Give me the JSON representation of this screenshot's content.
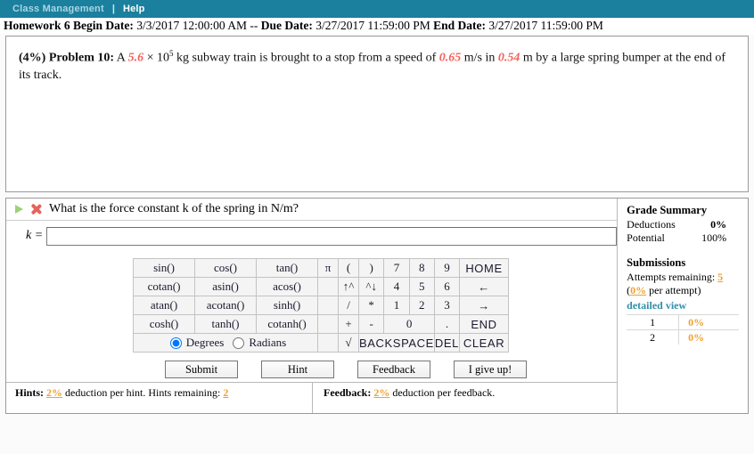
{
  "nav": {
    "class_management": "Class Management",
    "separator": "|",
    "help": "Help"
  },
  "header": {
    "hw_label": "Homework 6 Begin Date:",
    "begin_date": "3/3/2017 12:00:00 AM",
    "dash": "--",
    "due_label": "Due Date:",
    "due_date": "3/27/2017 11:59:00 PM",
    "end_label": "End Date:",
    "end_date": "3/27/2017 11:59:00 PM"
  },
  "problem": {
    "percent": "(4%)",
    "title": "Problem 10:",
    "t1": "A ",
    "mass": "5.6",
    "times": " × 10",
    "exp": "5",
    "t2": " kg subway train is brought to a stop from a speed of ",
    "speed": "0.65",
    "t3": " m/s in ",
    "distance": "0.54",
    "t4": " m by a large spring bumper at the end of its track."
  },
  "question": {
    "text": "What is the force constant k of the spring in N/m?",
    "answer_label": "k =",
    "answer_value": "",
    "answer_placeholder": ""
  },
  "calculator": {
    "rows": [
      [
        "sin()",
        "cos()",
        "tan()",
        "π",
        "(",
        ")",
        "7",
        "8",
        "9",
        "HOME"
      ],
      [
        "cotan()",
        "asin()",
        "acos()",
        "",
        "↑^",
        "^↓",
        "4",
        "5",
        "6",
        "←"
      ],
      [
        "atan()",
        "acotan()",
        "sinh()",
        "",
        "/",
        "*",
        "1",
        "2",
        "3",
        "→"
      ],
      [
        "cosh()",
        "tanh()",
        "cotanh()",
        "",
        "+",
        "-",
        "0",
        ".",
        "END"
      ],
      [
        "",
        "√",
        "BACKSPACE",
        "DEL",
        "CLEAR"
      ]
    ],
    "angle_mode": {
      "degrees": "Degrees",
      "radians": "Radians",
      "selected": "Degrees"
    }
  },
  "buttons": {
    "submit": "Submit",
    "hint": "Hint",
    "feedback": "Feedback",
    "give_up": "I give up!"
  },
  "hints_footer": {
    "hints_label": "Hints:",
    "hints_pct": "2%",
    "hints_text": "deduction per hint. Hints remaining:",
    "hints_remaining": "2",
    "feedback_label": "Feedback:",
    "feedback_pct": "2%",
    "feedback_text": "deduction per feedback."
  },
  "grade_summary": {
    "title": "Grade Summary",
    "deductions_label": "Deductions",
    "deductions_value": "0%",
    "potential_label": "Potential",
    "potential_value": "100%",
    "submissions_title": "Submissions",
    "attempts_label": "Attempts remaining:",
    "attempts_value": "5",
    "per_attempt_pct": "0%",
    "per_attempt_text": "per attempt)",
    "per_attempt_open": "(",
    "detailed_view": "detailed view",
    "rows": [
      {
        "index": "1",
        "score": "0%"
      },
      {
        "index": "2",
        "score": "0%"
      }
    ]
  },
  "colors": {
    "nav_teal": "#1b7f9e",
    "value_red": "#f4615a",
    "accent_orange": "#f0a030",
    "link_teal": "#2f8fa8"
  }
}
